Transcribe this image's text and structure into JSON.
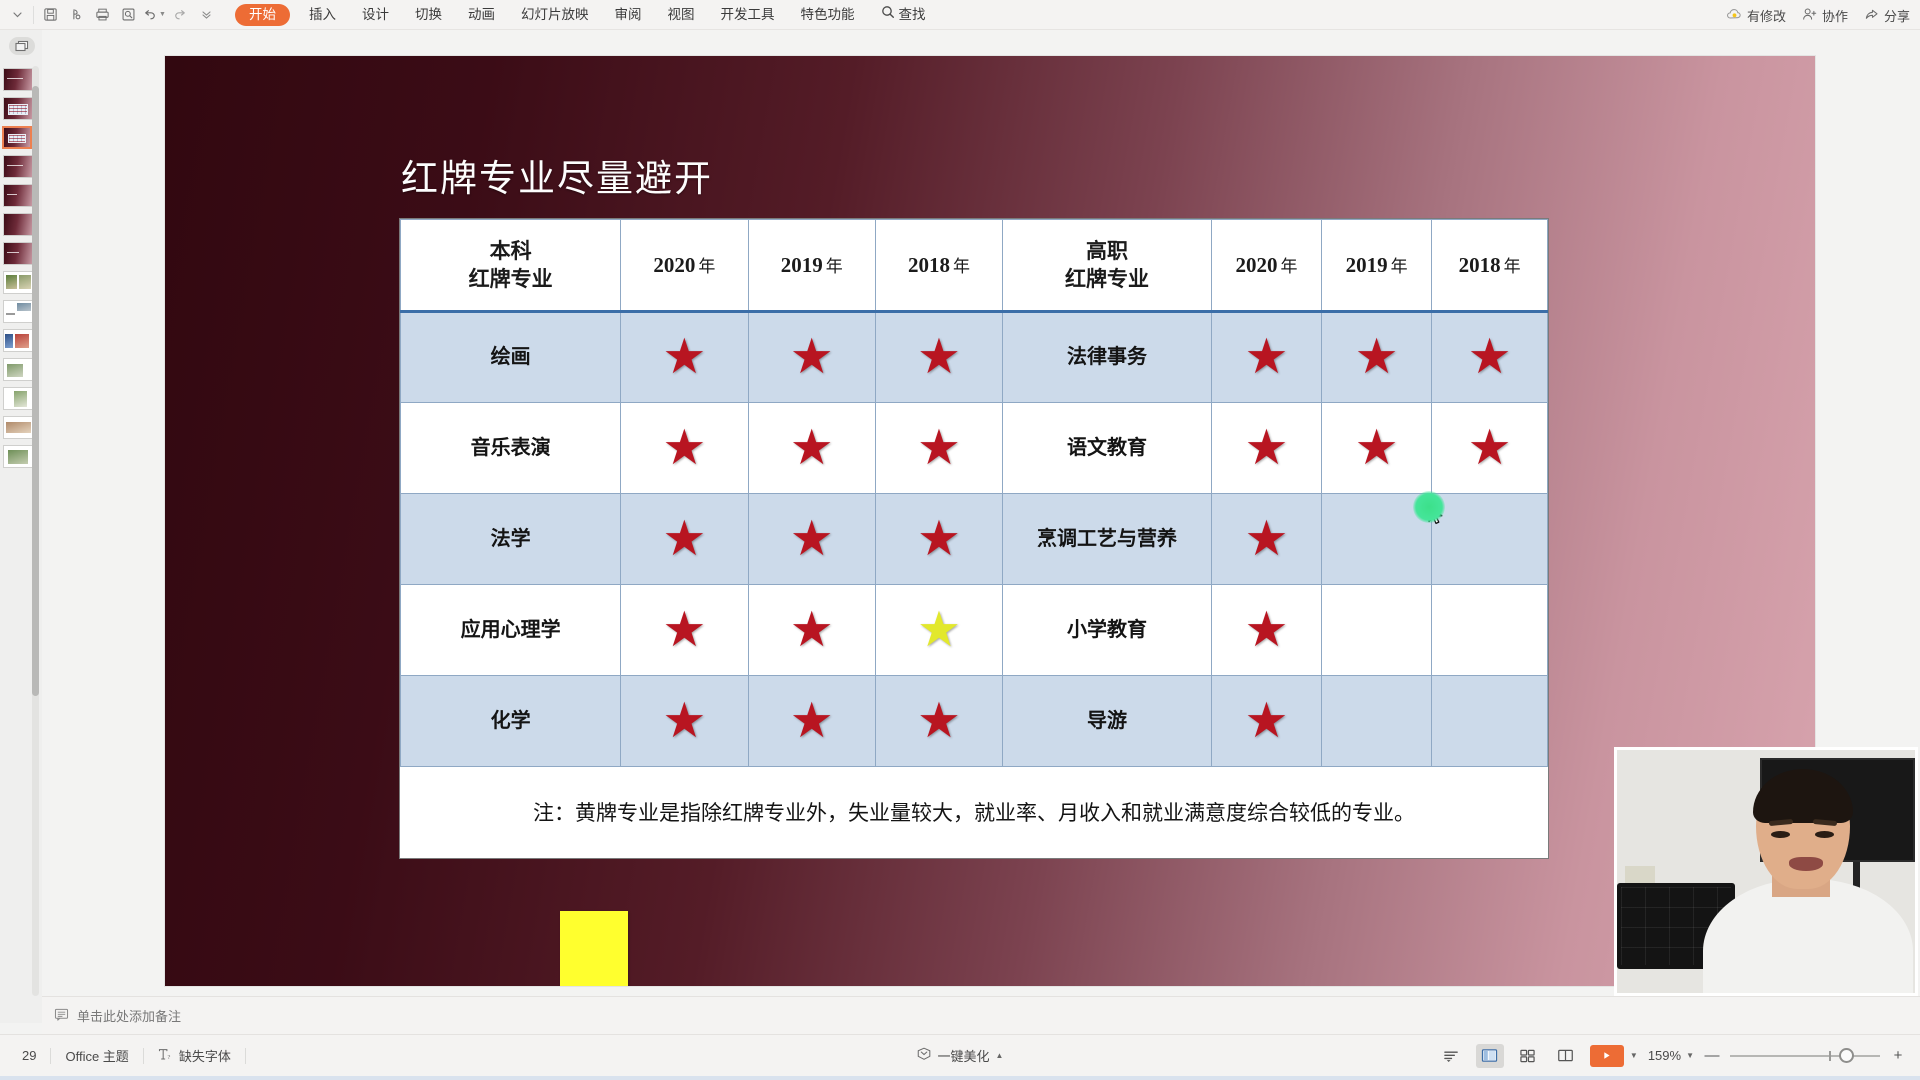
{
  "app": {
    "quick_access": [
      {
        "name": "menu-chevron-icon",
        "label": "⌄"
      },
      {
        "name": "save-icon",
        "label": "Save"
      },
      {
        "name": "cloud-sync-icon",
        "label": "Sync"
      },
      {
        "name": "print-icon",
        "label": "Print"
      },
      {
        "name": "print-preview-icon",
        "label": "Print Preview"
      },
      {
        "name": "undo-icon",
        "label": "Undo"
      },
      {
        "name": "redo-icon",
        "label": "Redo"
      },
      {
        "name": "more-qat-icon",
        "label": "More"
      }
    ],
    "tabs": [
      {
        "label": "开始",
        "active": true
      },
      {
        "label": "插入",
        "active": false
      },
      {
        "label": "设计",
        "active": false
      },
      {
        "label": "切换",
        "active": false
      },
      {
        "label": "动画",
        "active": false
      },
      {
        "label": "幻灯片放映",
        "active": false
      },
      {
        "label": "审阅",
        "active": false
      },
      {
        "label": "视图",
        "active": false
      },
      {
        "label": "开发工具",
        "active": false
      },
      {
        "label": "特色功能",
        "active": false
      },
      {
        "label": "查找",
        "active": false
      }
    ],
    "right_actions": [
      {
        "label": "有修改",
        "icon": "cloud-modified-icon"
      },
      {
        "label": "协作",
        "icon": "collaborate-icon"
      },
      {
        "label": "分享",
        "icon": "share-icon"
      }
    ]
  },
  "sidebar": {
    "toggle_icon": "slide-panel-toggle-icon",
    "selected_index": 2,
    "thumbnails": [
      {
        "kind": "title"
      },
      {
        "kind": "table"
      },
      {
        "kind": "table"
      },
      {
        "kind": "title"
      },
      {
        "kind": "title"
      },
      {
        "kind": "title"
      },
      {
        "kind": "title"
      },
      {
        "kind": "photo"
      },
      {
        "kind": "photo"
      },
      {
        "kind": "photo"
      },
      {
        "kind": "photo"
      },
      {
        "kind": "photo"
      },
      {
        "kind": "photo"
      },
      {
        "kind": "photo"
      }
    ]
  },
  "slide": {
    "title": "红牌专业尽量避开",
    "background_gradient": [
      "#320810",
      "#d8a4ae"
    ],
    "footnote": "注：黄牌专业是指除红牌专业外，失业量较大，就业率、月收入和就业满意度综合较低的专业。",
    "yellow_shape_color": "#ffff2e",
    "table": {
      "headers": [
        {
          "line1": "本科",
          "line2": "红牌专业"
        },
        {
          "year": "2020",
          "unit": "年"
        },
        {
          "year": "2019",
          "unit": "年"
        },
        {
          "year": "2018",
          "unit": "年"
        },
        {
          "line1": "高职",
          "line2": "红牌专业"
        },
        {
          "year": "2020",
          "unit": "年"
        },
        {
          "year": "2019",
          "unit": "年"
        },
        {
          "year": "2018",
          "unit": "年"
        }
      ],
      "rows": [
        {
          "undergrad": "绘画",
          "u2020": "red",
          "u2019": "red",
          "u2018": "red",
          "vocational": "法律事务",
          "v2020": "red",
          "v2019": "red",
          "v2018": "red",
          "shaded": true
        },
        {
          "undergrad": "音乐表演",
          "u2020": "red",
          "u2019": "red",
          "u2018": "red",
          "vocational": "语文教育",
          "v2020": "red",
          "v2019": "red",
          "v2018": "red",
          "shaded": false
        },
        {
          "undergrad": "法学",
          "u2020": "red",
          "u2019": "red",
          "u2018": "red",
          "vocational": "烹调工艺与营养",
          "v2020": "red",
          "v2019": "",
          "v2018": "",
          "shaded": true
        },
        {
          "undergrad": "应用心理学",
          "u2020": "red",
          "u2019": "red",
          "u2018": "yellow",
          "vocational": "小学教育",
          "v2020": "red",
          "v2019": "",
          "v2018": "",
          "shaded": false
        },
        {
          "undergrad": "化学",
          "u2020": "red",
          "u2019": "red",
          "u2018": "red",
          "vocational": "导游",
          "v2020": "red",
          "v2019": "",
          "v2018": "",
          "shaded": true
        }
      ],
      "star_colors": {
        "red": "#b81521",
        "yellow": "#e2e82c"
      },
      "shaded_row_color": "#ccdaea",
      "header_rule_color": "#3b6ea8"
    }
  },
  "notes": {
    "placeholder": "单击此处添加备注",
    "icon": "notes-icon"
  },
  "status": {
    "slide_number": "29",
    "theme": "Office 主题",
    "font_warning": "缺失字体",
    "beautify": "一键美化",
    "zoom": "159%",
    "views": [
      {
        "name": "outline-view-button",
        "active": false
      },
      {
        "name": "normal-view-button",
        "active": true
      },
      {
        "name": "slide-sorter-button",
        "active": false
      },
      {
        "name": "reading-view-button",
        "active": false
      }
    ],
    "play_label": "▶",
    "accent_color": "#ed6c35"
  }
}
